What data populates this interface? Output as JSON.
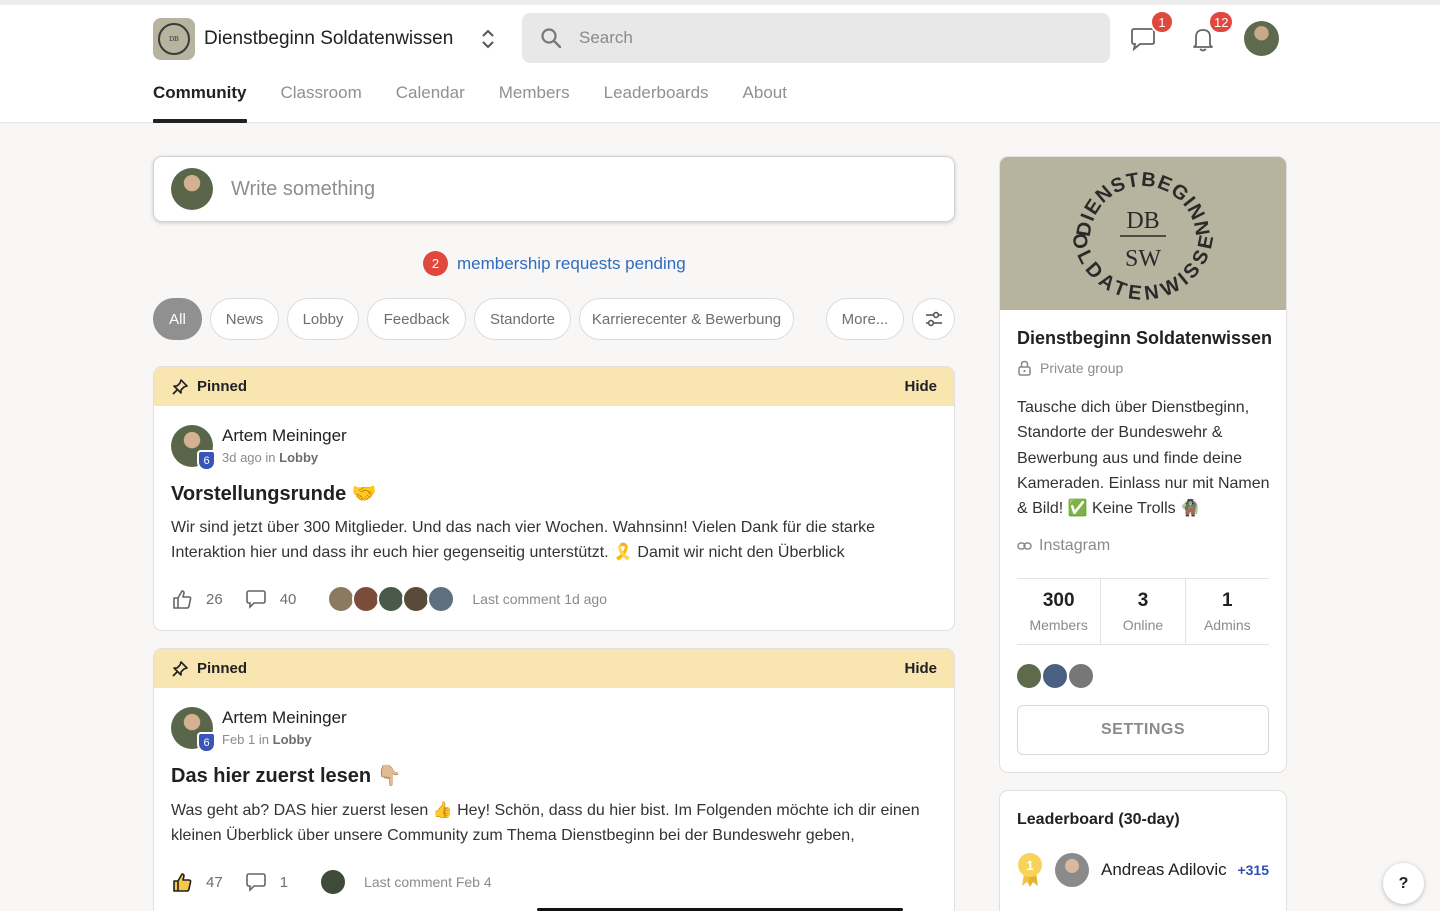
{
  "app": {
    "name": "Dienstbeginn Soldatenwissen",
    "logo_top_text": "DIENSTBEGINN",
    "logo_mid_top": "DB",
    "logo_mid_bottom": "SW",
    "logo_bottom_text": "SOLDATENWISSEN"
  },
  "search": {
    "placeholder": "Search"
  },
  "header": {
    "chat_badge": "1",
    "notif_badge": "12"
  },
  "nav": {
    "tabs": [
      {
        "label": "Community",
        "active": true
      },
      {
        "label": "Classroom"
      },
      {
        "label": "Calendar"
      },
      {
        "label": "Members"
      },
      {
        "label": "Leaderboards"
      },
      {
        "label": "About"
      }
    ]
  },
  "composer": {
    "placeholder": "Write something"
  },
  "requests": {
    "count": "2",
    "text": "membership requests pending"
  },
  "filters": {
    "chips": [
      "All",
      "News",
      "Lobby",
      "Feedback",
      "Standorte",
      "Karrierecenter & Bewerbung",
      "More..."
    ],
    "active": "All"
  },
  "posts": [
    {
      "pinned_label": "Pinned",
      "hide_label": "Hide",
      "author": "Artem Meininger",
      "level": "6",
      "time": "3d ago",
      "in_word": "in",
      "category": "Lobby",
      "title": "Vorstellungsrunde 🤝",
      "body": "Wir sind jetzt über 300 Mitglieder. Und das nach vier Wochen. Wahnsinn! Vielen Dank für die starke Interaktion hier und dass ihr euch hier gegenseitig unterstützt. 🎗️ Damit wir nicht den Überblick",
      "likes": "26",
      "comments": "40",
      "last_comment": "Last comment 1d ago"
    },
    {
      "pinned_label": "Pinned",
      "hide_label": "Hide",
      "author": "Artem Meininger",
      "level": "6",
      "time": "Feb 1",
      "in_word": "in",
      "category": "Lobby",
      "title": "Das hier zuerst lesen 👇🏼",
      "body": "Was geht ab? DAS hier zuerst lesen 👍 Hey! Schön, dass du hier bist. Im Folgenden möchte ich dir einen kleinen Überblick über unsere Community zum Thema Dienstbeginn bei der Bundeswehr geben,",
      "likes": "47",
      "comments": "1",
      "last_comment": "Last comment Feb 4"
    }
  ],
  "sidebar": {
    "title": "Dienstbeginn Soldatenwissen",
    "privacy": "Private group",
    "description": "Tausche dich über Dienstbeginn, Standorte der Bundeswehr & Bewerbung aus und finde deine Kameraden. Einlass nur mit Namen & Bild! ✅ Keine Trolls 🧌",
    "link": "Instagram",
    "stats": [
      {
        "value": "300",
        "label": "Members"
      },
      {
        "value": "3",
        "label": "Online"
      },
      {
        "value": "1",
        "label": "Admins"
      }
    ],
    "settings_label": "SETTINGS"
  },
  "leaderboard": {
    "title": "Leaderboard (30-day)",
    "entries": [
      {
        "rank": "1",
        "name": "Andreas Adilovic",
        "points": "+315"
      }
    ]
  },
  "help": {
    "label": "?"
  },
  "colors": {
    "accent_red": "#e0483d",
    "link_blue": "#2f6bc1",
    "pin_yellow": "#f8e5b0",
    "level_blue": "#3a55b8",
    "banner_khaki": "#b6b39e"
  }
}
